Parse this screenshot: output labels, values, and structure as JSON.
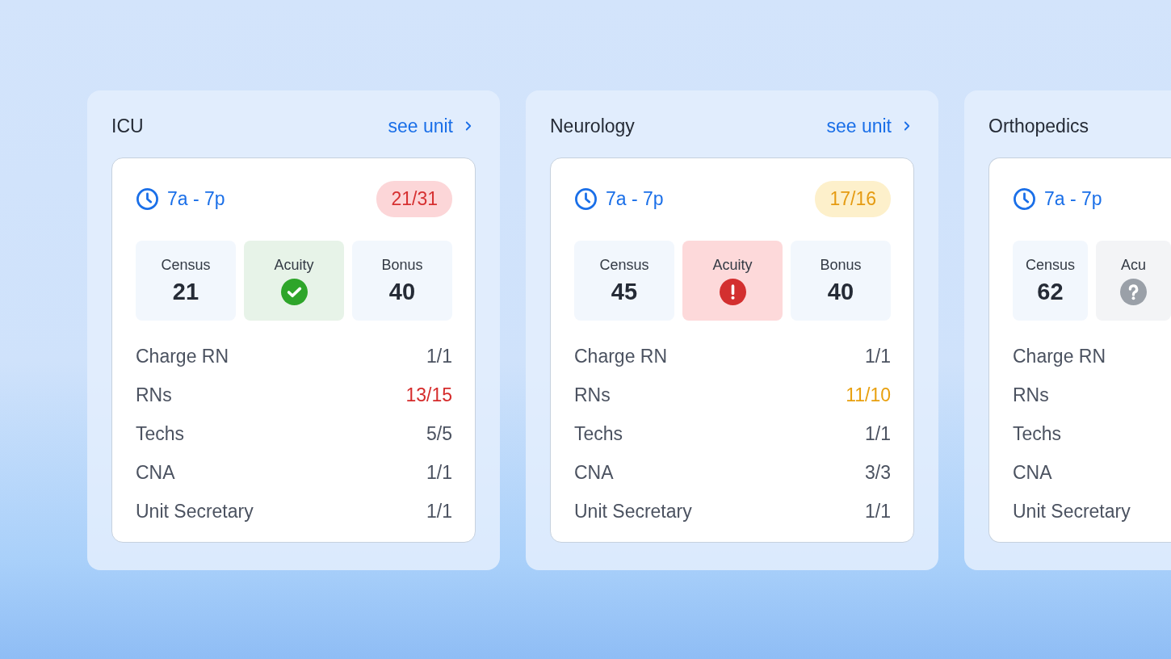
{
  "units": [
    {
      "title": "ICU",
      "link": "see unit",
      "shift": {
        "time": "7a - 7p",
        "badge": {
          "text": "21/31",
          "color": "#d63031"
        }
      },
      "tiles": [
        {
          "kind": "number",
          "label": "Census",
          "value": "21"
        },
        {
          "kind": "check",
          "label": "Acuity"
        },
        {
          "kind": "number",
          "label": "Bonus",
          "value": "40"
        }
      ],
      "rows": [
        {
          "label": "Charge RN",
          "value": "1/1",
          "color": "#4b5260"
        },
        {
          "label": "RNs",
          "value": "13/15",
          "color": "#d52b2b"
        },
        {
          "label": "Techs",
          "value": "5/5",
          "color": "#4b5260"
        },
        {
          "label": "CNA",
          "value": "1/1",
          "color": "#4b5260"
        },
        {
          "label": "Unit Secretary",
          "value": "1/1",
          "color": "#4b5260"
        }
      ]
    },
    {
      "title": "Neurology",
      "link": "see unit",
      "shift": {
        "time": "7a - 7p",
        "badge": {
          "text": "17/16",
          "color": "#e59b12"
        }
      },
      "tiles": [
        {
          "kind": "number",
          "label": "Census",
          "value": "45"
        },
        {
          "kind": "alert",
          "label": "Acuity"
        },
        {
          "kind": "number",
          "label": "Bonus",
          "value": "40"
        }
      ],
      "rows": [
        {
          "label": "Charge RN",
          "value": "1/1",
          "color": "#4b5260"
        },
        {
          "label": "RNs",
          "value": "11/10",
          "color": "#e8a00f"
        },
        {
          "label": "Techs",
          "value": "1/1",
          "color": "#4b5260"
        },
        {
          "label": "CNA",
          "value": "3/3",
          "color": "#4b5260"
        },
        {
          "label": "Unit Secretary",
          "value": "1/1",
          "color": "#4b5260"
        }
      ]
    },
    {
      "title": "Orthopedics",
      "shift": {
        "time": "7a - 7p"
      },
      "tiles": [
        {
          "kind": "number",
          "label": "Census",
          "value": "62"
        },
        {
          "kind": "unknown",
          "label": "Acu"
        }
      ],
      "rows": [
        {
          "label": "Charge RN"
        },
        {
          "label": "RNs"
        },
        {
          "label": "Techs"
        },
        {
          "label": "CNA"
        },
        {
          "label": "Unit Secretary"
        }
      ]
    }
  ]
}
